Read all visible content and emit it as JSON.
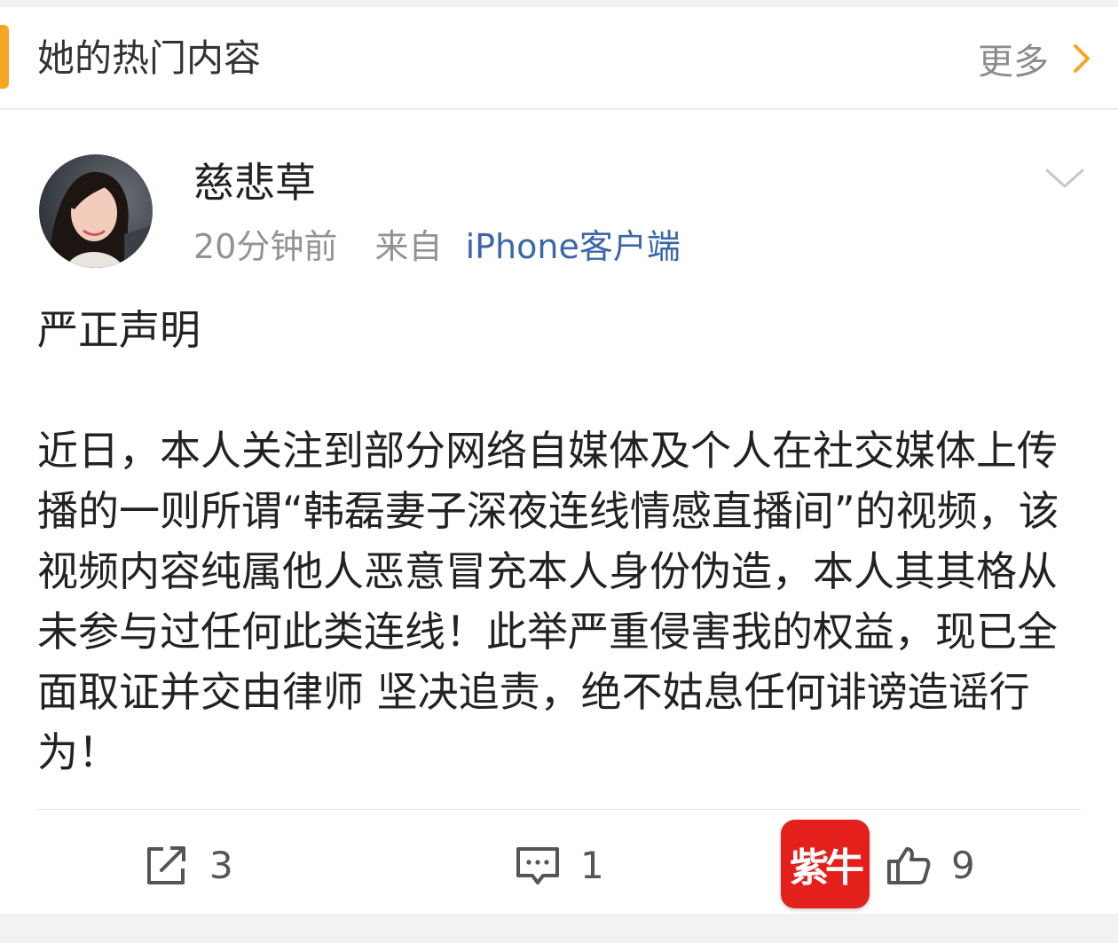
{
  "section": {
    "title": "她的热门内容",
    "more_label": "更多",
    "accent_color": "#f5a623"
  },
  "post": {
    "author": "慈悲草",
    "time": "20分钟前",
    "source_prefix": "来自",
    "source_link": "iPhone客户端",
    "link_color": "#3b67a8",
    "title": "严正声明",
    "body": "近日，本人关注到部分网络自媒体及个人在社交媒体上传播的一则所谓“韩磊妻子深夜连线情感直播间”的视频，该视频内容纯属他人恶意冒充本人身份伪造，本人其其格从未参与过任何此类连线！此举严重侵害我的权益，现已全面取证并交由律师 坚决追责，绝不姑息任何诽谤造谣行为！"
  },
  "actions": {
    "repost_count": "3",
    "comment_count": "1",
    "like_count": "9"
  },
  "watermark": {
    "text": "紫牛",
    "color": "#e3201b"
  },
  "icons": {
    "more": "chevron-right-icon",
    "dropdown": "chevron-down-icon",
    "repost": "repost-icon",
    "comment": "comment-icon",
    "like": "thumbs-up-icon"
  }
}
